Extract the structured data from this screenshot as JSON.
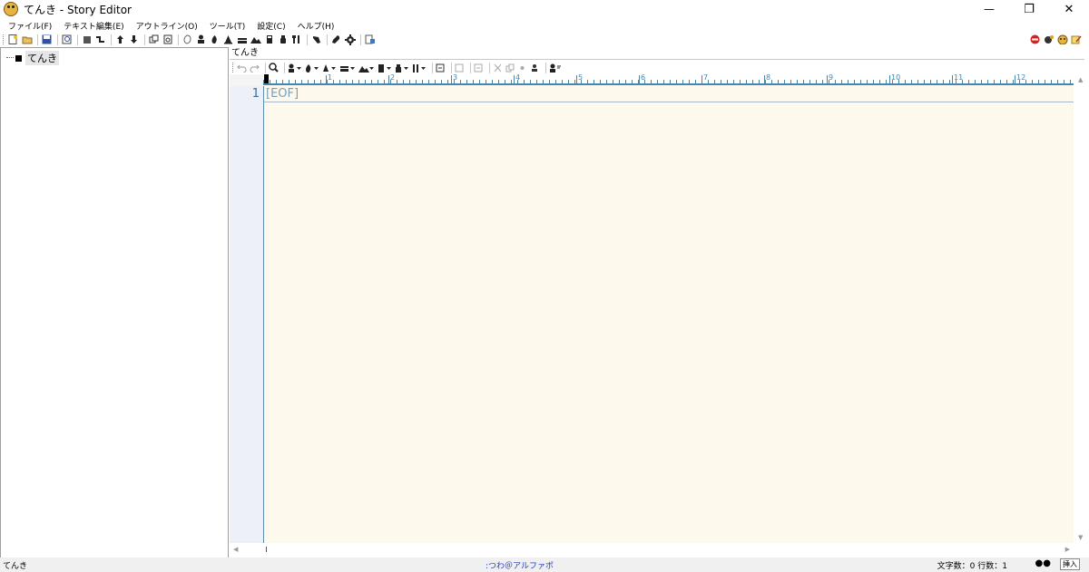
{
  "window": {
    "title": "てんき - Story Editor",
    "minimize_glyph": "—",
    "restore_glyph": "❐",
    "close_glyph": "✕"
  },
  "menu": [
    {
      "label": "ファイル(F)"
    },
    {
      "label": "テキスト編集(E)"
    },
    {
      "label": "アウトライン(O)"
    },
    {
      "label": "ツール(T)"
    },
    {
      "label": "設定(C)"
    },
    {
      "label": "ヘルプ(H)"
    }
  ],
  "tree": {
    "root_label": "てんき"
  },
  "editor": {
    "doc_title": "てんき",
    "line_number": "1",
    "eof_marker": "[EOF]",
    "ruler_numbers": [
      "1",
      "2",
      "3",
      "4",
      "5",
      "6",
      "7",
      "8",
      "9",
      "10",
      "11",
      "12"
    ]
  },
  "status": {
    "left": "てんき",
    "center": ":つわ＠アルファポ",
    "counts": "文字数：0 行数：1",
    "dots": "●●",
    "mode": "挿入"
  },
  "colors": {
    "accent": "#4a86a8",
    "editor_bg": "#fdf9ec",
    "gutter_bg": "#eef0f8",
    "status_link": "#2040c0"
  }
}
